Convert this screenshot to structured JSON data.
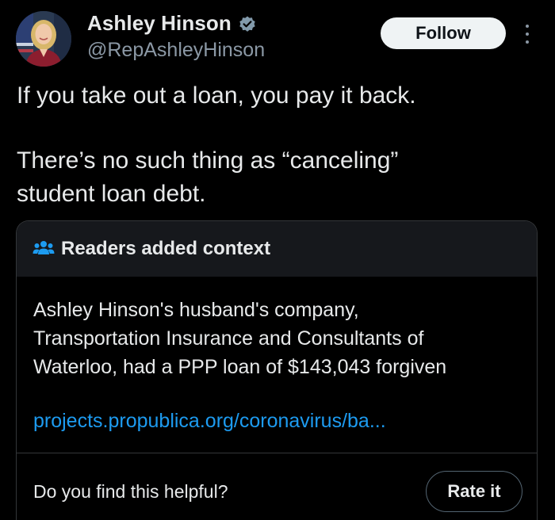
{
  "colors": {
    "background": "#000000",
    "text_primary": "#e7e9ea",
    "text_secondary": "#8b98a5",
    "link": "#1d9bf0",
    "verified_badge": "#829aab",
    "card_header_bg": "#16181c",
    "border": "#333639"
  },
  "author": {
    "display_name": "Ashley Hinson",
    "handle": "@RepAshleyHinson",
    "avatar_icon": "profile-photo",
    "verified_icon": "verified-badge-icon"
  },
  "actions": {
    "follow_label": "Follow",
    "more_icon": "more-options-icon"
  },
  "tweet": {
    "lines": [
      "If you take out a loan, you pay it back.",
      "There’s no such thing as “canceling”",
      "student loan debt."
    ]
  },
  "community_note": {
    "header_icon": "people-icon",
    "title": "Readers added context",
    "body_lines": [
      "Ashley Hinson's husband's company,",
      "Transportation Insurance and Consultants of",
      "Waterloo, had a PPP loan of $143,043 forgiven"
    ],
    "link_text": "projects.propublica.org/coronavirus/ba...",
    "helpful_question": "Do you find this helpful?",
    "rate_label": "Rate it"
  }
}
